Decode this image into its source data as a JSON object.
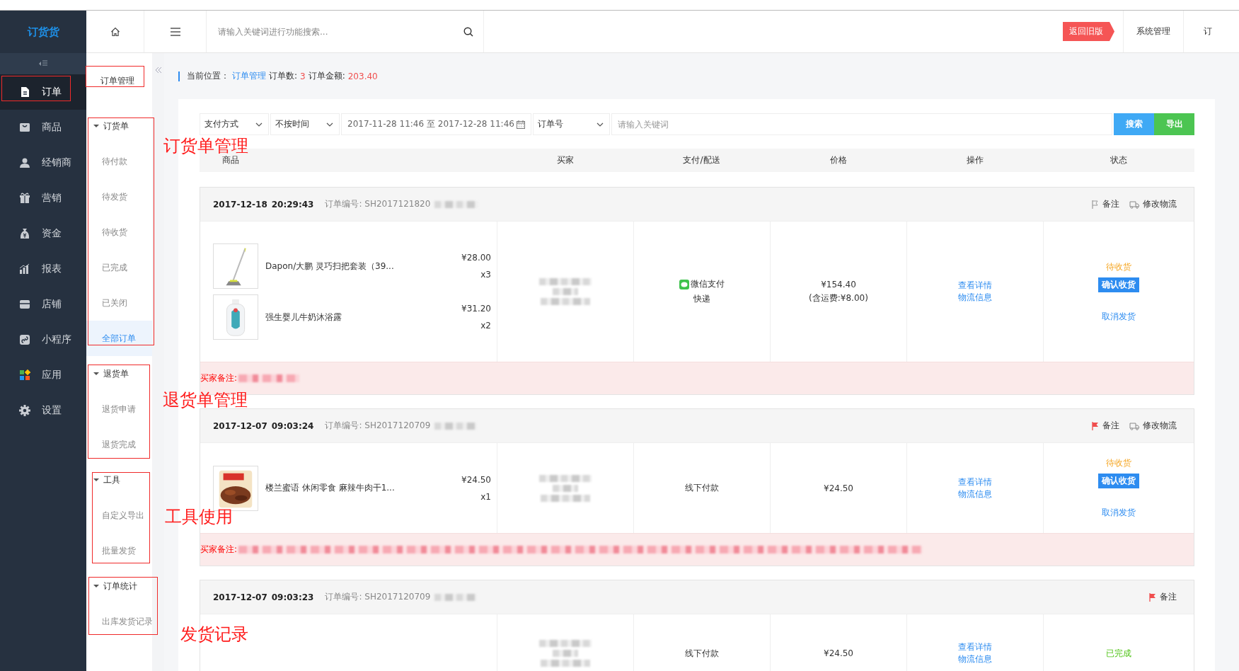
{
  "logo": "订货货",
  "nav": [
    {
      "label": "订单",
      "selected": true
    },
    {
      "label": "商品",
      "selected": false
    },
    {
      "label": "经销商",
      "selected": false
    },
    {
      "label": "营销",
      "selected": false
    },
    {
      "label": "资金",
      "selected": false
    },
    {
      "label": "报表",
      "selected": false
    },
    {
      "label": "店铺",
      "selected": false
    },
    {
      "label": "小程序",
      "selected": false
    },
    {
      "label": "应用",
      "selected": false
    },
    {
      "label": "设置",
      "selected": false
    }
  ],
  "header": {
    "search_placeholder": "请输入关键词进行功能搜索...",
    "old_version_button": "返回旧版",
    "tabs": [
      "系统管理",
      "订"
    ]
  },
  "subnav": {
    "title": "订单管理",
    "groups": [
      {
        "label": "订货单",
        "expanded": true,
        "items": [
          {
            "label": "待付款",
            "selected": false
          },
          {
            "label": "待发货",
            "selected": false
          },
          {
            "label": "待收货",
            "selected": false
          },
          {
            "label": "已完成",
            "selected": false
          },
          {
            "label": "已关闭",
            "selected": false
          },
          {
            "label": "全部订单",
            "selected": true
          }
        ]
      },
      {
        "label": "退货单",
        "expanded": true,
        "items": [
          {
            "label": "退货申请",
            "selected": false
          },
          {
            "label": "退货完成",
            "selected": false
          }
        ]
      },
      {
        "label": "工具",
        "expanded": true,
        "items": [
          {
            "label": "自定义导出",
            "selected": false
          },
          {
            "label": "批量发货",
            "selected": false
          }
        ]
      },
      {
        "label": "订单统计",
        "expanded": true,
        "items": [
          {
            "label": "出库发货记录",
            "selected": false
          }
        ]
      }
    ]
  },
  "breadcrumb": {
    "label": "当前位置：",
    "link": "订单管理",
    "count_label": "订单数:",
    "count": "3",
    "amount_label": "订单金额:",
    "amount": "203.40"
  },
  "filters": {
    "payment": "支付方式",
    "time": "不按时间",
    "date_range": "2017-11-28 11:46 至 2017-12-28 11:46",
    "field": "订单号",
    "keyword_placeholder": "请输入关键词",
    "buttons": [
      "搜索",
      "导出"
    ]
  },
  "table": {
    "columns": [
      "商品",
      "买家",
      "支付/配送",
      "价格",
      "操作",
      "状态"
    ],
    "orders": [
      {
        "date": "2017-12-18",
        "time": "20:29:43",
        "order_no": "订单编号: SH2017121820",
        "flagged": false,
        "note_action": "备注",
        "logistics_action": "修改物流",
        "items": [
          {
            "name": "Dapon/大鹏 灵巧扫把套装（39...",
            "price": "¥28.00",
            "qty": "x3"
          },
          {
            "name": "强生婴儿牛奶沐浴露",
            "price": "¥31.20",
            "qty": "x2"
          }
        ],
        "payment": {
          "kind": "wechat",
          "label": "微信支付"
        },
        "delivery": "快递",
        "price": "¥154.40",
        "shipping": "(含运费:¥8.00)",
        "links": [
          "查看详情",
          "物流信息"
        ],
        "status": {
          "kind": "pending",
          "label": "待收货"
        },
        "confirm_button": "确认收货",
        "cancel_link": "取消发货",
        "remark_label": "买家备注:"
      },
      {
        "date": "2017-12-07",
        "time": "09:03:24",
        "order_no": "订单编号: SH2017120709",
        "flagged": true,
        "note_action": "备注",
        "logistics_action": "修改物流",
        "items": [
          {
            "name": "楼兰蜜语 休闲零食 麻辣牛肉干1...",
            "price": "¥24.50",
            "qty": "x1"
          }
        ],
        "payment": {
          "kind": "offline",
          "label": "线下付款"
        },
        "price": "¥24.50",
        "links": [
          "查看详情",
          "物流信息"
        ],
        "status": {
          "kind": "pending",
          "label": "待收货"
        },
        "confirm_button": "确认收货",
        "cancel_link": "取消发货",
        "remark_label": "买家备注:"
      },
      {
        "date": "2017-12-07",
        "time": "09:03:23",
        "order_no": "订单编号: SH2017120709",
        "flagged": true,
        "note_action": "备注",
        "payment": {
          "kind": "offline",
          "label": "线下付款"
        },
        "price": "¥24.50",
        "links": [
          "查看详情",
          "物流信息"
        ],
        "status": {
          "kind": "done",
          "label": "已完成"
        }
      }
    ]
  },
  "annotations": [
    {
      "text": "订货单管理"
    },
    {
      "text": "退货单管理"
    },
    {
      "text": "工具使用"
    },
    {
      "text": "发货记录"
    }
  ]
}
